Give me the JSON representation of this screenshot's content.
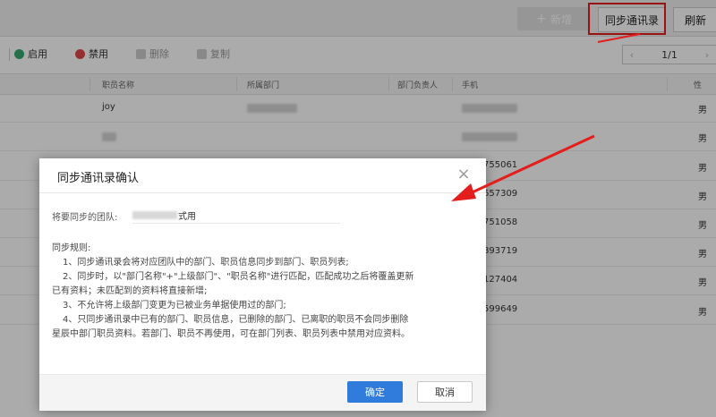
{
  "header": {
    "new_button": "新增",
    "new_icon": "plus-icon",
    "sync_button": "同步通讯录",
    "refresh_button": "刷新"
  },
  "toolbar": {
    "enable": "启用",
    "disable": "禁用",
    "delete": "删除",
    "copy": "复制"
  },
  "pager": {
    "text": "1/1",
    "prev": "‹",
    "next": "›"
  },
  "table": {
    "columns": [
      "职员名称",
      "所属部门",
      "部门负责人",
      "手机",
      "性"
    ],
    "rows": [
      {
        "name": "joy",
        "phone": "",
        "gender": "男"
      },
      {
        "name": "",
        "phone": "",
        "gender": "男"
      },
      {
        "name": "",
        "phone": "755061",
        "gender": "男"
      },
      {
        "name": "",
        "phone": "657309",
        "gender": "男"
      },
      {
        "name": "",
        "phone": "751058",
        "gender": "男"
      },
      {
        "name": "",
        "phone": "893719",
        "gender": "男"
      },
      {
        "name": "",
        "phone": "127404",
        "gender": "男"
      },
      {
        "name": "",
        "phone": "599649",
        "gender": "男"
      }
    ]
  },
  "dialog": {
    "title": "同步通讯录确认",
    "team_label": "将要同步的团队:",
    "team_value": "式用",
    "rules_title": "同步规则:",
    "rules": [
      "1、同步通讯录会将对应团队中的部门、职员信息同步到部门、职员列表;",
      "2、同步时，以\"部门名称\"+\"上级部门\"、\"职员名称\"进行匹配，匹配成功之后将覆盖更新",
      "已有资料；未匹配到的资料将直接新增;",
      "3、不允许将上级部门变更为已被业务单据使用过的部门;",
      "4、只同步通讯录中已有的部门、职员信息，已删除的部门、已离职的职员不会同步删除",
      "星辰中部门职员资料。若部门、职员不再使用，可在部门列表、职员列表中禁用对应资料。"
    ],
    "confirm": "确定",
    "cancel": "取消"
  },
  "colors": {
    "primary": "#2f7cdc",
    "annotation": "#e41d1d"
  }
}
